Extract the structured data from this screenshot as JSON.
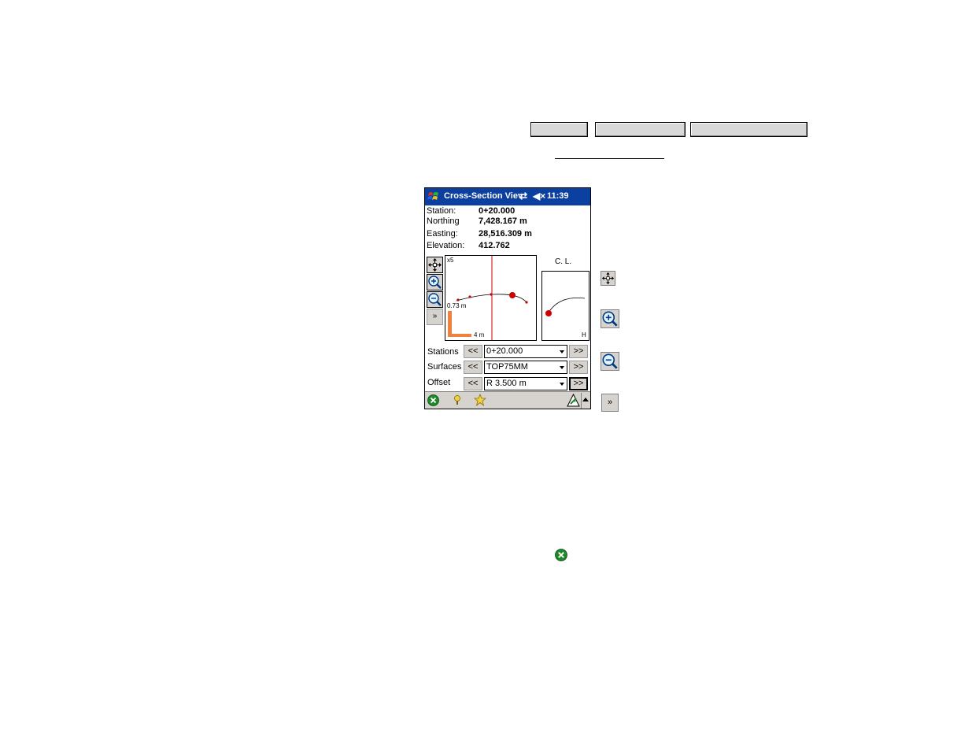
{
  "device": {
    "title": "Cross-Section View",
    "title_display": "Cross-Section Viev",
    "time": "11:39",
    "sync_glyph": "⇄",
    "speaker_glyph": "◀×"
  },
  "info": {
    "station_label": "Station:",
    "station_value": "0+20.000",
    "northing_label": "Northing",
    "northing_value": "7,428.167 m",
    "easting_label": "Easting:",
    "easting_value": "28,516.309 m",
    "elevation_label": "Elevation:",
    "elevation_value": "412.762"
  },
  "plot": {
    "vertical_exaggeration": "x5",
    "vertical_scale": "0.73 m",
    "horizontal_scale": "4 m",
    "cl_label": "C. L.",
    "cl_corner": "H"
  },
  "controls": {
    "more_button": "»",
    "stations_label": "Stations",
    "stations_value": "0+20.000",
    "surfaces_label": "Surfaces",
    "surfaces_value": "TOP75MM",
    "offset_label": "Offset",
    "offset_value": "R 3.500 m",
    "prev": "<<",
    "next": ">>"
  },
  "legend": {
    "more_button": "»"
  },
  "colors": {
    "titlebar": "#0b3fa0",
    "button_face": "#d6d3ce",
    "accent_red": "#cc0000",
    "scale_orange": "#f08040"
  },
  "icons": [
    "windows-start-icon",
    "sync-icon",
    "speaker-muted-icon",
    "zoom-extents-icon",
    "zoom-in-icon",
    "zoom-out-icon",
    "close-icon",
    "help-icon",
    "favorites-icon",
    "gps-status-icon",
    "arrow-up-icon"
  ]
}
